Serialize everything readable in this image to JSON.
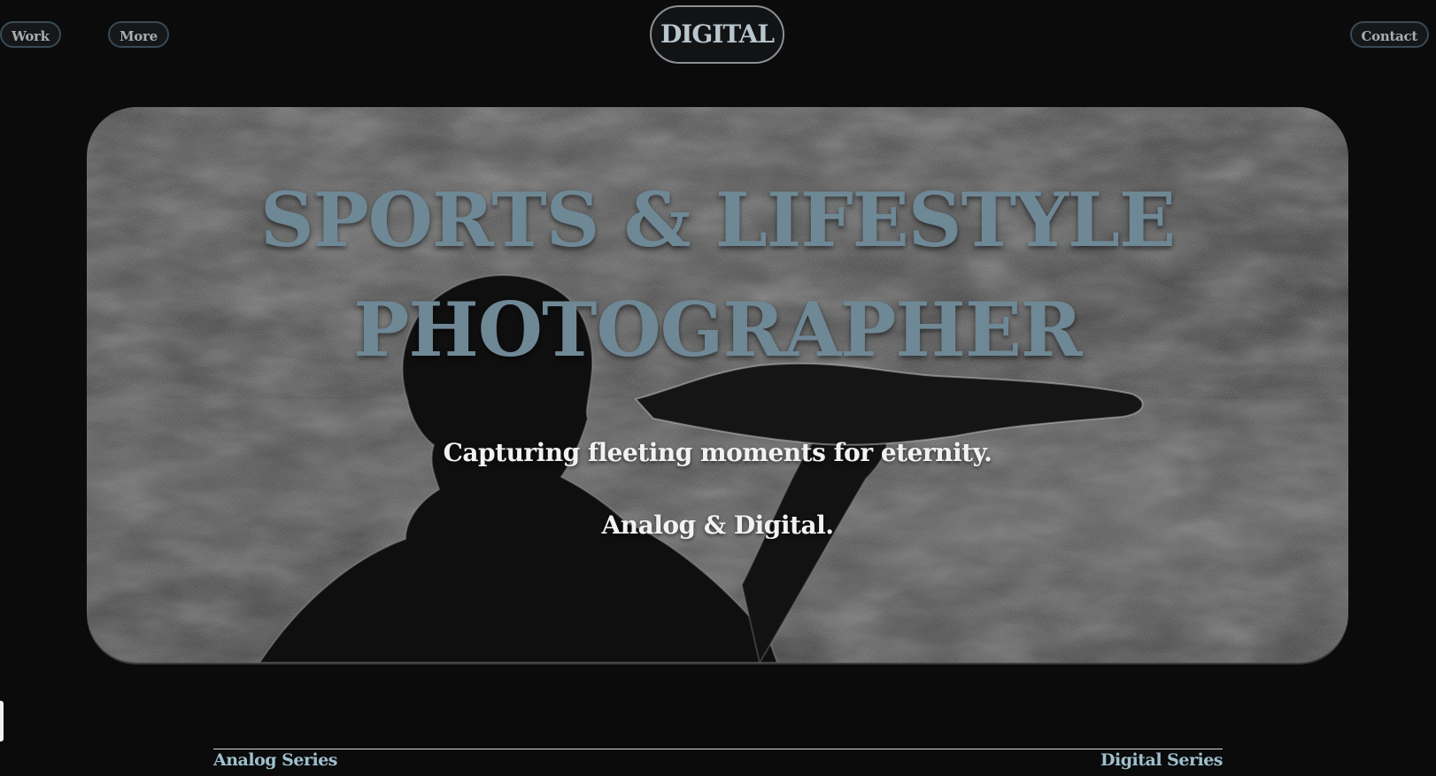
{
  "nav": {
    "work_label": "Work",
    "more_label": "More",
    "contact_label": "Contact",
    "logo_label": "DIGITAL"
  },
  "hero": {
    "title_line1": "SPORTS & LIFESTYLE",
    "title_line2": "PHOTOGRAPHER",
    "tagline": "Capturing fleeting moments for eternity.",
    "formats": "Analog & Digital.",
    "background_image": "silhouette-photo"
  },
  "series": {
    "analog_label": "Analog Series",
    "digital_label": "Digital Series"
  },
  "colors": {
    "background": "#0b0b0c",
    "title": "#6f8896",
    "series_link": "#9fc0cd",
    "nav_border": "#3a4a55"
  }
}
